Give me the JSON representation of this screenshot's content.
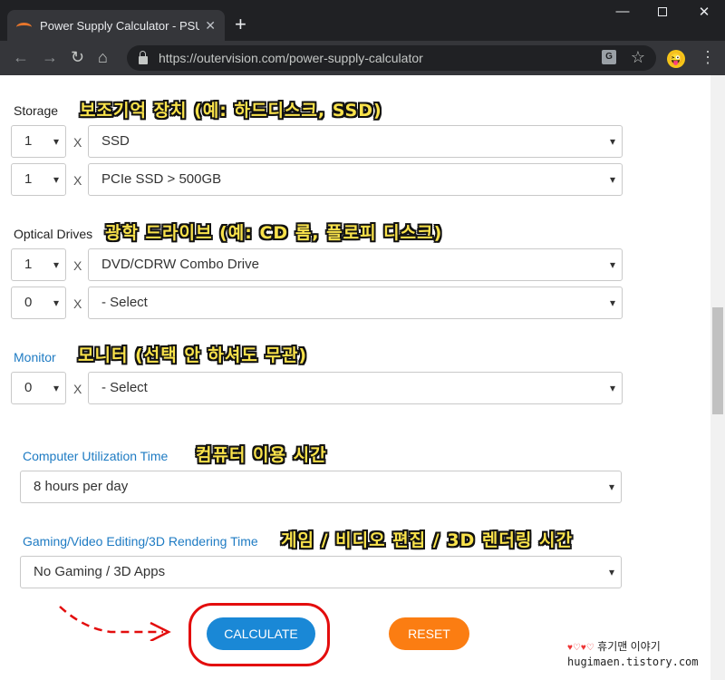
{
  "browser": {
    "tab_title": "Power Supply Calculator - PSU C",
    "tab_close": "✕",
    "new_tab": "+",
    "url": "https://outervision.com/power-supply-calculator",
    "window_controls": {
      "minimize": "—",
      "close": "✕"
    }
  },
  "storage": {
    "label": "Storage",
    "annotation": "보조기억 장치 (예: 하드디스크, SSD)",
    "rows": [
      {
        "qty": "1",
        "times": "X",
        "value": "SSD"
      },
      {
        "qty": "1",
        "times": "X",
        "value": "PCIe SSD > 500GB"
      }
    ]
  },
  "optical": {
    "label": "Optical Drives",
    "annotation": "광학 드라이브 (예: CD 롬, 플로피 디스크)",
    "rows": [
      {
        "qty": "1",
        "times": "X",
        "value": "DVD/CDRW Combo Drive"
      },
      {
        "qty": "0",
        "times": "X",
        "value": "- Select"
      }
    ]
  },
  "monitor": {
    "label": "Monitor",
    "annotation": "모니터 (선택 안 하셔도 무관)",
    "rows": [
      {
        "qty": "0",
        "times": "X",
        "value": "- Select"
      }
    ]
  },
  "utilization": {
    "label": "Computer Utilization Time",
    "annotation": "컴퓨터 이용 시간",
    "value": "8 hours per day"
  },
  "gaming": {
    "label": "Gaming/Video Editing/3D Rendering Time",
    "annotation": "게임 / 비디오 편집 / 3D 렌더링 시간",
    "value": "No Gaming / 3D Apps"
  },
  "buttons": {
    "calculate": "CALCULATE",
    "reset": "RESET"
  },
  "watermark": {
    "hearts": "♥♡♥♡",
    "name": "휴기맨 이야기",
    "url": "hugimaen.tistory.com"
  },
  "colors": {
    "accent_blue": "#1a88d6",
    "reset_orange": "#fb7d12",
    "annotation_yellow": "#f9e24b",
    "highlight_red": "#e30d0d"
  }
}
